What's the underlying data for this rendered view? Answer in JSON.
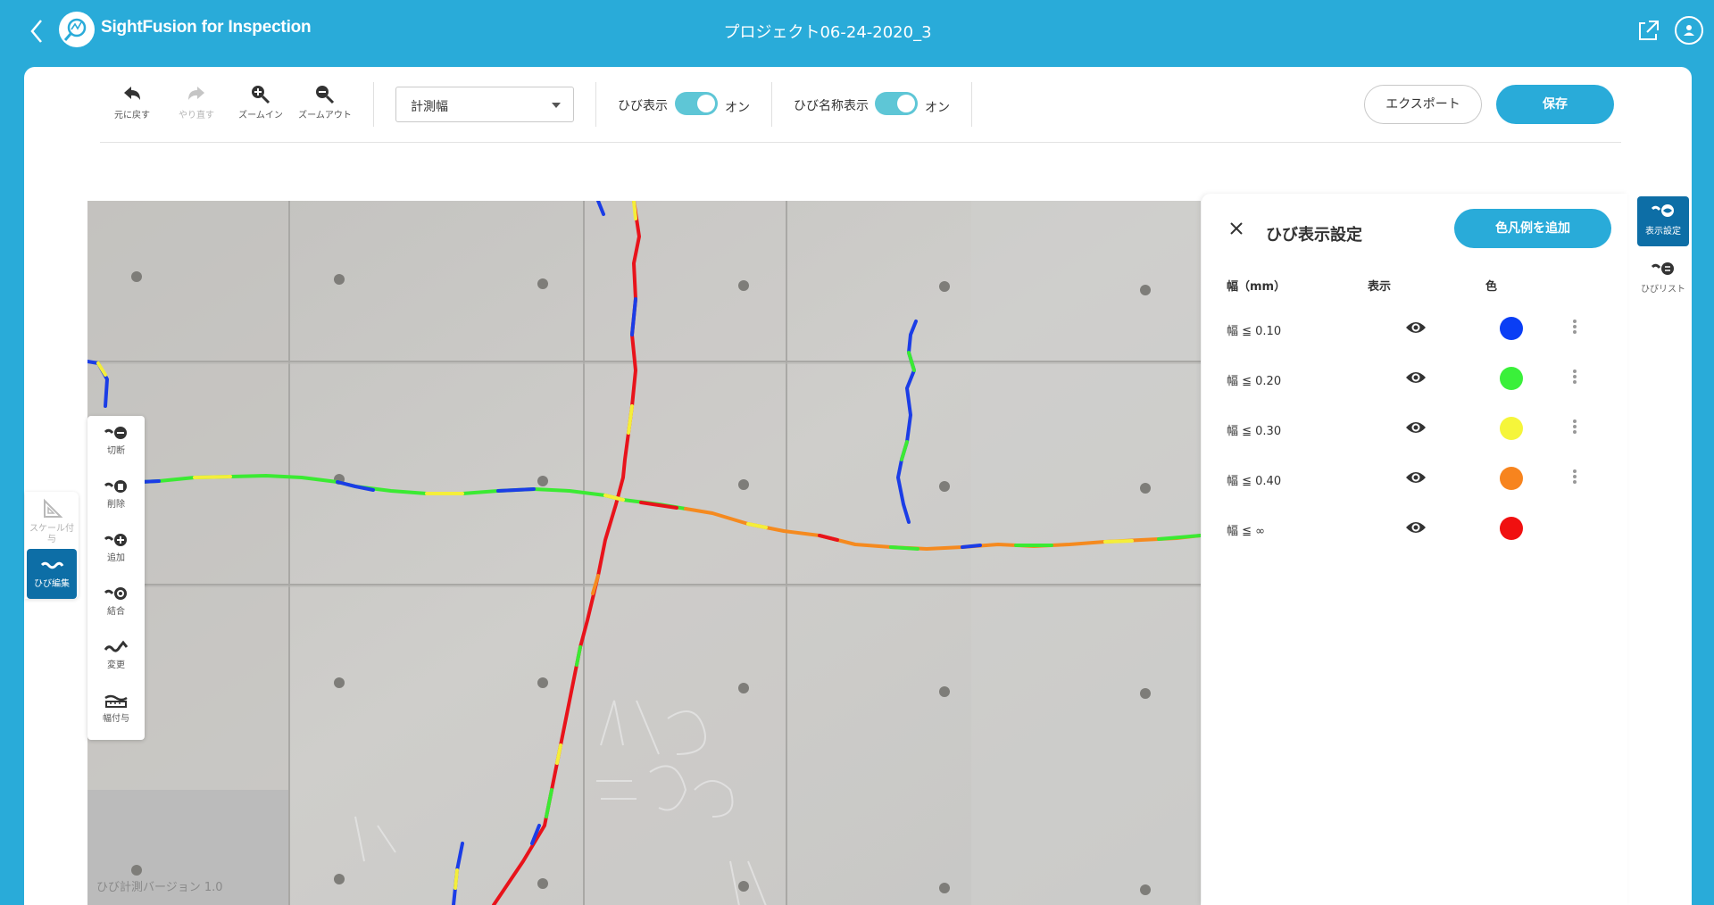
{
  "header": {
    "app_title": "SightFusion for Inspection",
    "project_title": "プロジェクト06-24-2020_3"
  },
  "toolbar": {
    "undo": "元に戻す",
    "redo": "やり直す",
    "zoom_in": "ズームイン",
    "zoom_out": "ズームアウト",
    "measure_select": "計測幅",
    "crack_display_label": "ひび表示",
    "crack_display_state": "オン",
    "crack_name_label": "ひび名称表示",
    "crack_name_state": "オン",
    "export": "エクスポート",
    "save": "保存"
  },
  "left_rail": {
    "scale": "スケール付与",
    "crack_edit": "ひび編集"
  },
  "edit_tools": [
    "切断",
    "削除",
    "追加",
    "結合",
    "変更",
    "幅付与"
  ],
  "canvas": {
    "version": "ひび計測バージョン 1.0"
  },
  "settings": {
    "title": "ひび表示設定",
    "add_legend": "色凡例を追加",
    "col_width": "幅（mm）",
    "col_visible": "表示",
    "col_color": "色",
    "rows": [
      {
        "label": "幅 ≦ 0.10",
        "color": "#0a3ef5",
        "menu": true
      },
      {
        "label": "幅 ≦ 0.20",
        "color": "#3af03a",
        "menu": true
      },
      {
        "label": "幅 ≦ 0.30",
        "color": "#f5f53a",
        "menu": true
      },
      {
        "label": "幅 ≦ 0.40",
        "color": "#f7841e",
        "menu": true
      },
      {
        "label": "幅 ≦ ∞",
        "color": "#f01010",
        "menu": false
      }
    ]
  },
  "right_tabs": {
    "display_settings": "表示設定",
    "crack_list": "ひびリスト"
  },
  "colors": {
    "brand": "#29abd9",
    "active": "#0d6ea6",
    "toggle": "#5ec6d6"
  }
}
